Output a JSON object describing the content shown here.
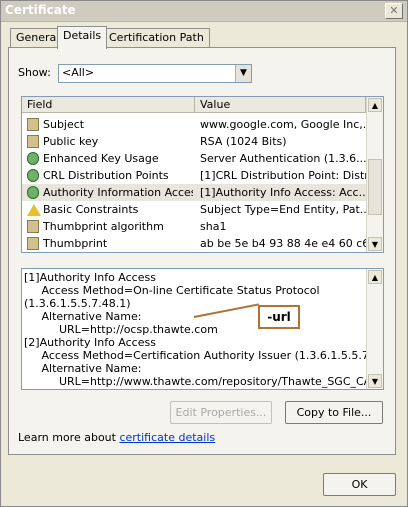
{
  "window": {
    "title": "Certificate",
    "close_glyph": "✕"
  },
  "tabs": [
    "General",
    "Details",
    "Certification Path"
  ],
  "show": {
    "label": "Show:",
    "value": "<All>"
  },
  "table": {
    "headers": [
      "Field",
      "Value"
    ],
    "rows": [
      {
        "field": "Subject",
        "value": "www.google.com, Google Inc,..."
      },
      {
        "field": "Public key",
        "value": "RSA (1024 Bits)"
      },
      {
        "field": "Enhanced Key Usage",
        "value": "Server Authentication (1.3.6...."
      },
      {
        "field": "CRL Distribution Points",
        "value": "[1]CRL Distribution Point: Distr..."
      },
      {
        "field": "Authority Information Access",
        "value": "[1]Authority Info Access: Acc..."
      },
      {
        "field": "Basic Constraints",
        "value": "Subject Type=End Entity, Pat..."
      },
      {
        "field": "Thumbprint algorithm",
        "value": "sha1"
      },
      {
        "field": "Thumbprint",
        "value": "ab be 5e b4 93 88 4e e4 60 c6..."
      }
    ]
  },
  "details": {
    "lines": [
      "[1]Authority Info Access",
      "     Access Method=On-line Certificate Status Protocol",
      "(1.3.6.1.5.5.7.48.1)",
      "     Alternative Name:",
      "          URL=http://ocsp.thawte.com",
      "[2]Authority Info Access",
      "     Access Method=Certification Authority Issuer (1.3.6.1.5.5.7.48.2)",
      "     Alternative Name:",
      "          URL=http://www.thawte.com/repository/Thawte_SGC_CA.crt"
    ]
  },
  "annotation": "-url",
  "buttons": {
    "edit_properties": "Edit Properties...",
    "copy_to_file": "Copy to File...",
    "ok": "OK"
  },
  "learn": {
    "prefix": "Learn more about ",
    "link": "certificate details"
  }
}
